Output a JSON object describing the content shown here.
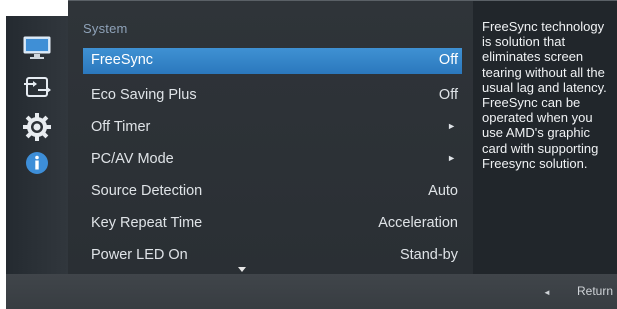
{
  "menu": {
    "title": "System",
    "items": [
      {
        "label": "FreeSync",
        "value": "Off",
        "selected": true
      },
      {
        "label": "Eco Saving Plus",
        "value": "Off"
      },
      {
        "label": "Off Timer",
        "value": "►"
      },
      {
        "label": "PC/AV Mode",
        "value": "►"
      },
      {
        "label": "Source Detection",
        "value": "Auto"
      },
      {
        "label": "Key Repeat Time",
        "value": "Acceleration"
      },
      {
        "label": "Power LED On",
        "value": "Stand-by"
      }
    ]
  },
  "sidebar": {
    "icons": [
      "monitor-icon",
      "input-source-icon",
      "gear-icon",
      "info-icon"
    ],
    "active": "gear-icon"
  },
  "help": {
    "text": "FreeSync technology is solution that eliminates screen tearing without all the usual lag and latency. FreeSync can be operated when you use AMD's graphic card with supporting Freesync solution."
  },
  "footer": {
    "return_label": "Return",
    "arrow": "◄"
  },
  "colors": {
    "selection": "#2f86d0",
    "menu_bg": "#2d3237",
    "help_bg": "#21262b",
    "title": "#8ea2b8"
  }
}
